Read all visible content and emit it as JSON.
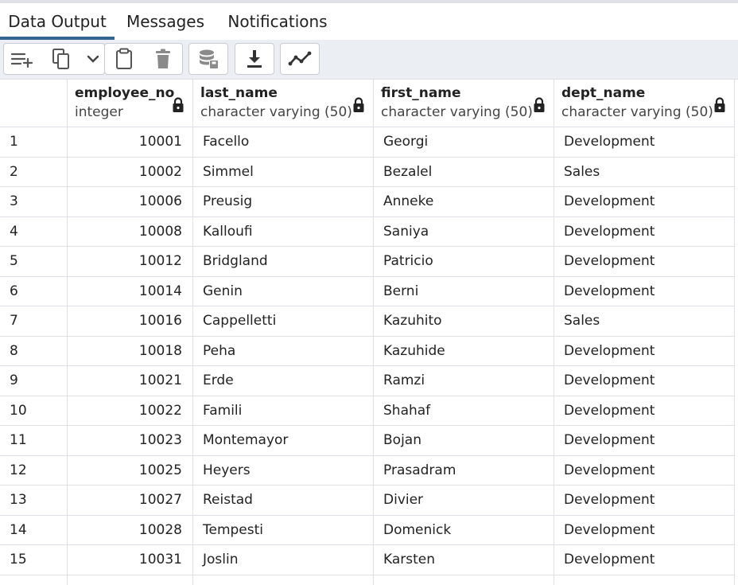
{
  "tabs": [
    {
      "label": "Data Output",
      "active": true
    },
    {
      "label": "Messages",
      "active": false
    },
    {
      "label": "Notifications",
      "active": false
    }
  ],
  "toolbar": {
    "buttons": [
      {
        "name": "add-row-button",
        "icon": "add-row-icon"
      },
      {
        "name": "copy-button",
        "icon": "copy-icon"
      },
      {
        "name": "copy-options-dropdown",
        "icon": "chevron-down-icon"
      },
      {
        "name": "paste-button",
        "icon": "clipboard-icon"
      },
      {
        "name": "delete-button",
        "icon": "trash-icon"
      },
      {
        "name": "save-data-button",
        "icon": "database-save-icon"
      },
      {
        "name": "download-button",
        "icon": "download-icon"
      },
      {
        "name": "graph-visualiser-button",
        "icon": "line-chart-icon"
      }
    ]
  },
  "colors": {
    "accent": "#326690",
    "toolbar_bg": "#ebeef3",
    "border": "#dde0e6",
    "icon": "#555555"
  },
  "columns": [
    {
      "name": "employee_no",
      "type": "integer",
      "align": "right"
    },
    {
      "name": "last_name",
      "type": "character varying (50)",
      "align": "left"
    },
    {
      "name": "first_name",
      "type": "character varying (50)",
      "align": "left"
    },
    {
      "name": "dept_name",
      "type": "character varying (50)",
      "align": "left"
    }
  ],
  "rows": [
    {
      "n": "1",
      "cells": [
        "10001",
        "Facello",
        "Georgi",
        "Development"
      ]
    },
    {
      "n": "2",
      "cells": [
        "10002",
        "Simmel",
        "Bezalel",
        "Sales"
      ]
    },
    {
      "n": "3",
      "cells": [
        "10006",
        "Preusig",
        "Anneke",
        "Development"
      ]
    },
    {
      "n": "4",
      "cells": [
        "10008",
        "Kalloufi",
        "Saniya",
        "Development"
      ]
    },
    {
      "n": "5",
      "cells": [
        "10012",
        "Bridgland",
        "Patricio",
        "Development"
      ]
    },
    {
      "n": "6",
      "cells": [
        "10014",
        "Genin",
        "Berni",
        "Development"
      ]
    },
    {
      "n": "7",
      "cells": [
        "10016",
        "Cappelletti",
        "Kazuhito",
        "Sales"
      ]
    },
    {
      "n": "8",
      "cells": [
        "10018",
        "Peha",
        "Kazuhide",
        "Development"
      ]
    },
    {
      "n": "9",
      "cells": [
        "10021",
        "Erde",
        "Ramzi",
        "Development"
      ]
    },
    {
      "n": "10",
      "cells": [
        "10022",
        "Famili",
        "Shahaf",
        "Development"
      ]
    },
    {
      "n": "11",
      "cells": [
        "10023",
        "Montemayor",
        "Bojan",
        "Development"
      ]
    },
    {
      "n": "12",
      "cells": [
        "10025",
        "Heyers",
        "Prasadram",
        "Development"
      ]
    },
    {
      "n": "13",
      "cells": [
        "10027",
        "Reistad",
        "Divier",
        "Development"
      ]
    },
    {
      "n": "14",
      "cells": [
        "10028",
        "Tempesti",
        "Domenick",
        "Development"
      ]
    },
    {
      "n": "15",
      "cells": [
        "10031",
        "Joslin",
        "Karsten",
        "Development"
      ]
    }
  ]
}
